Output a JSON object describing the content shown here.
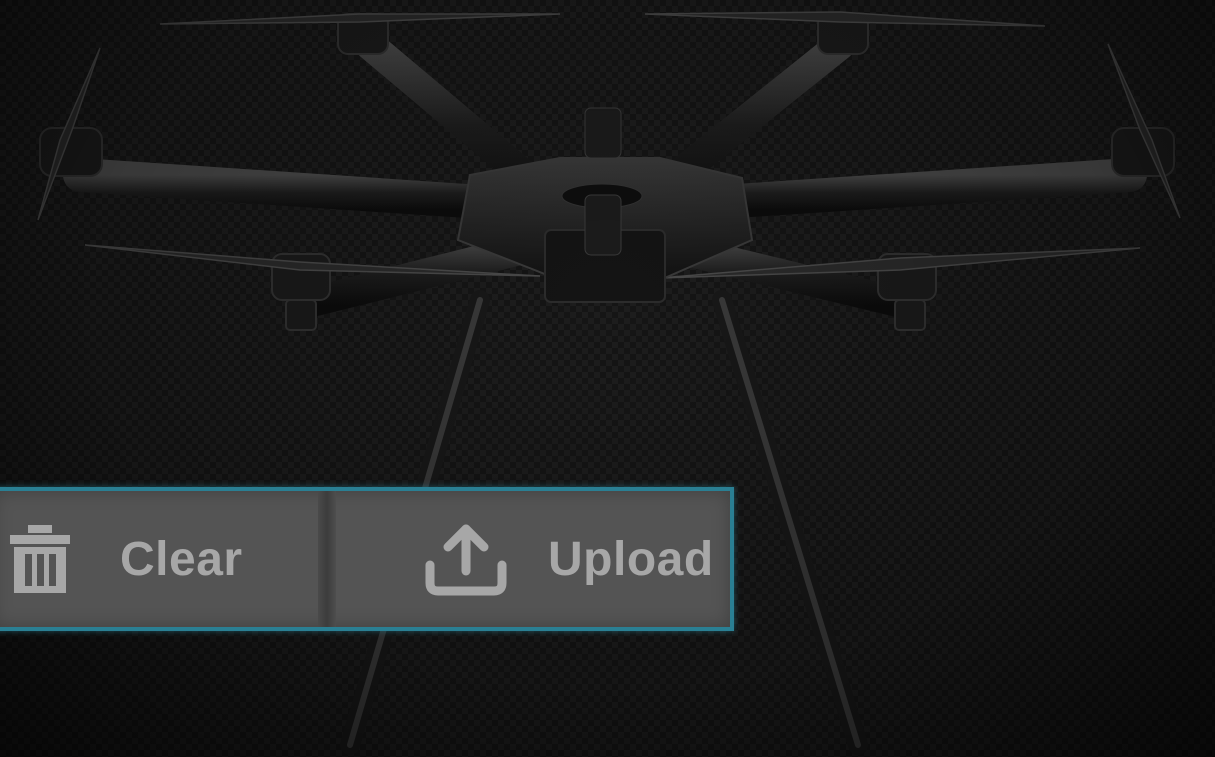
{
  "background": {
    "color": "#151515"
  },
  "toolbar": {
    "border_color": "#2a7f93",
    "clear": {
      "label": "Clear",
      "icon": "trash-icon"
    },
    "upload": {
      "label": "Upload",
      "icon": "upload-icon"
    }
  }
}
